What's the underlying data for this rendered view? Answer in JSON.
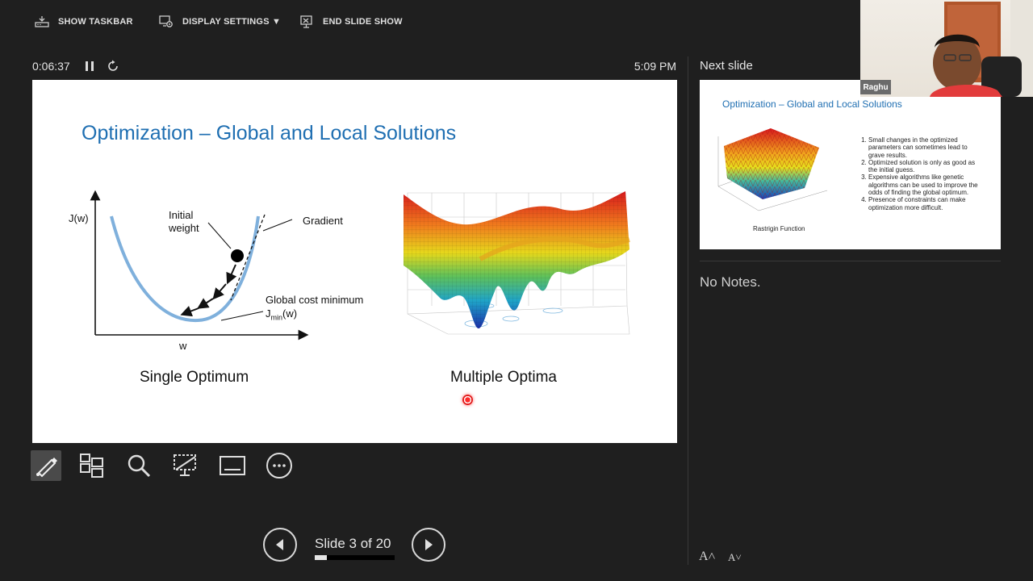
{
  "toolbar": {
    "show_taskbar": "SHOW TASKBAR",
    "display_settings": "DISPLAY SETTINGS ▼",
    "end_slide_show": "END SLIDE SHOW"
  },
  "timer": {
    "elapsed": "0:06:37",
    "clock": "5:09 PM"
  },
  "slide": {
    "title": "Optimization – Global and Local Solutions",
    "left_plot": {
      "y_label": "J(w)",
      "x_label": "w",
      "initial_weight_line1": "Initial",
      "initial_weight_line2": "weight",
      "gradient": "Gradient",
      "global_min": "Global cost minimum",
      "jmin_j": "J",
      "jmin_sub": "min",
      "jmin_w": "(w)"
    },
    "caption_left": "Single Optimum",
    "caption_right": "Multiple Optima"
  },
  "navigation": {
    "slide_counter": "Slide 3 of 20",
    "current": 3,
    "total": 20
  },
  "next_slide": {
    "label": "Next slide",
    "title": "Optimization – Global and Local Solutions",
    "items": [
      "Small changes in the optimized parameters can sometimes lead to grave results.",
      "Optimized solution is only as good as the initial guess.",
      "Expensive algorithms like genetic algorithms can be used to improve the odds of finding the global optimum.",
      "Presence of constraints can make optimization more difficult."
    ],
    "caption": "Rastrigin Function"
  },
  "notes": {
    "text": "No Notes."
  },
  "webcam": {
    "name": "Raghu"
  },
  "colors": {
    "title_blue": "#1f6fb2",
    "curve_blue": "#7fb0dc",
    "background": "#1f1f1f"
  }
}
